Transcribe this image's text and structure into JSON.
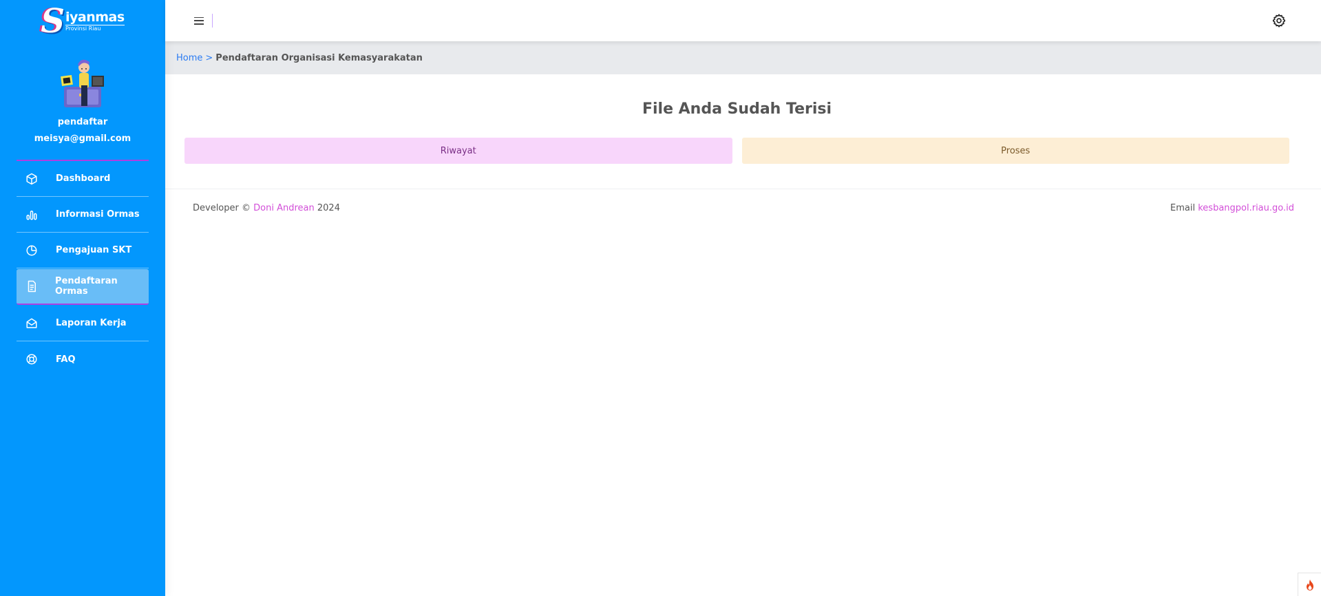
{
  "brand": {
    "logo_letter": "S",
    "logo_main": "iyanmas",
    "logo_sub": "Provinsi Riau"
  },
  "user": {
    "role": "pendaftar",
    "email": "meisya@gmail.com"
  },
  "sidebar": {
    "items": [
      {
        "label": "Dashboard",
        "icon": "box-icon"
      },
      {
        "label": "Informasi Ormas",
        "icon": "bar-chart-icon"
      },
      {
        "label": "Pengajuan SKT",
        "icon": "pie-chart-icon"
      },
      {
        "label": "Pendaftaran Ormas",
        "icon": "document-icon",
        "active": true
      },
      {
        "label": "Laporan Kerja",
        "icon": "mail-open-icon"
      },
      {
        "label": "FAQ",
        "icon": "life-ring-icon"
      }
    ]
  },
  "breadcrumb": {
    "home": "Home",
    "separator": ">",
    "current": "Pendaftaran Organisasi Kemasyarakatan"
  },
  "main": {
    "title": "File Anda Sudah Terisi",
    "tabs": [
      {
        "label": "Riwayat"
      },
      {
        "label": "Proses"
      }
    ]
  },
  "footer": {
    "developer_prefix": "Developer ©",
    "developer_name": "Doni Andrean",
    "year": "2024",
    "email_prefix": "Email",
    "email": "kesbangpol.riau.go.id"
  },
  "colors": {
    "sidebar_bg": "#0397fd",
    "active_item_bg": "#69bdf7",
    "accent_purple": "#b03ee2",
    "link_blue": "#2a7bf2",
    "link_pink": "#d24ed8",
    "tab_riwayat_bg": "#f8d6fb",
    "tab_proses_bg": "#fdeed5"
  }
}
